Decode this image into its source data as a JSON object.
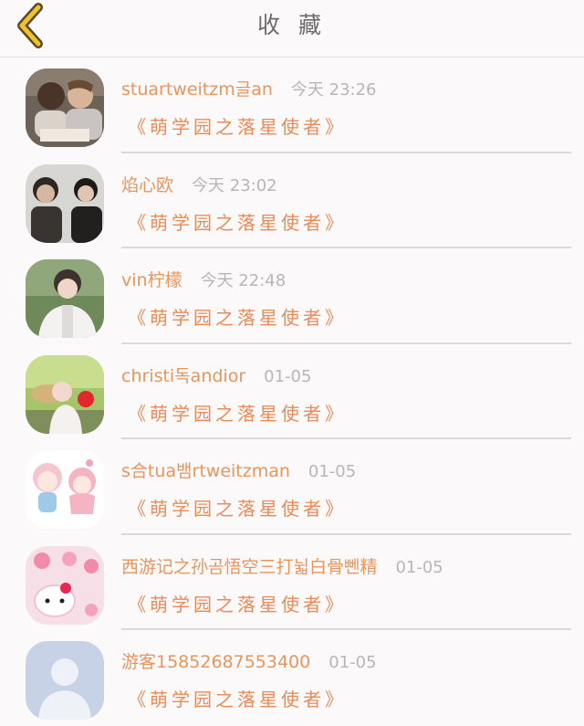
{
  "header": {
    "title": "收 藏"
  },
  "colors": {
    "accent": "#f0c12a",
    "name": "#e8955c",
    "time": "#b9b5b7",
    "book": "#e98b58",
    "divider": "#dcd8da"
  },
  "favorites": [
    {
      "user": "stuartweitzm글an",
      "time": "今天 23:26",
      "book": "《萌学园之落星使者》",
      "avatar": "kids-photo"
    },
    {
      "user": "焰心欧",
      "time": "今天 23:02",
      "book": "《萌学园之落星使者》",
      "avatar": "two-people-photo"
    },
    {
      "user": "vin柠檬",
      "time": "今天 22:48",
      "book": "《萌学园之落星使者》",
      "avatar": "boy-white-jacket-photo"
    },
    {
      "user": "christi독andior",
      "time": "01-05",
      "book": "《萌学园之落星使者》",
      "avatar": "girl-hat-photo"
    },
    {
      "user": "s合tua뱀rtweitzman",
      "time": "01-05",
      "book": "《萌学园之落星使者》",
      "avatar": "cartoon-kids"
    },
    {
      "user": "西游记之孙곰悟空三打뉣白骨뻰精",
      "time": "01-05",
      "book": "《萌学园之落星使者》",
      "avatar": "hello-kitty-photo"
    },
    {
      "user": "游客15852687553400",
      "time": "01-05",
      "book": "《萌学园之落星使者》",
      "avatar": "default-avatar"
    }
  ]
}
